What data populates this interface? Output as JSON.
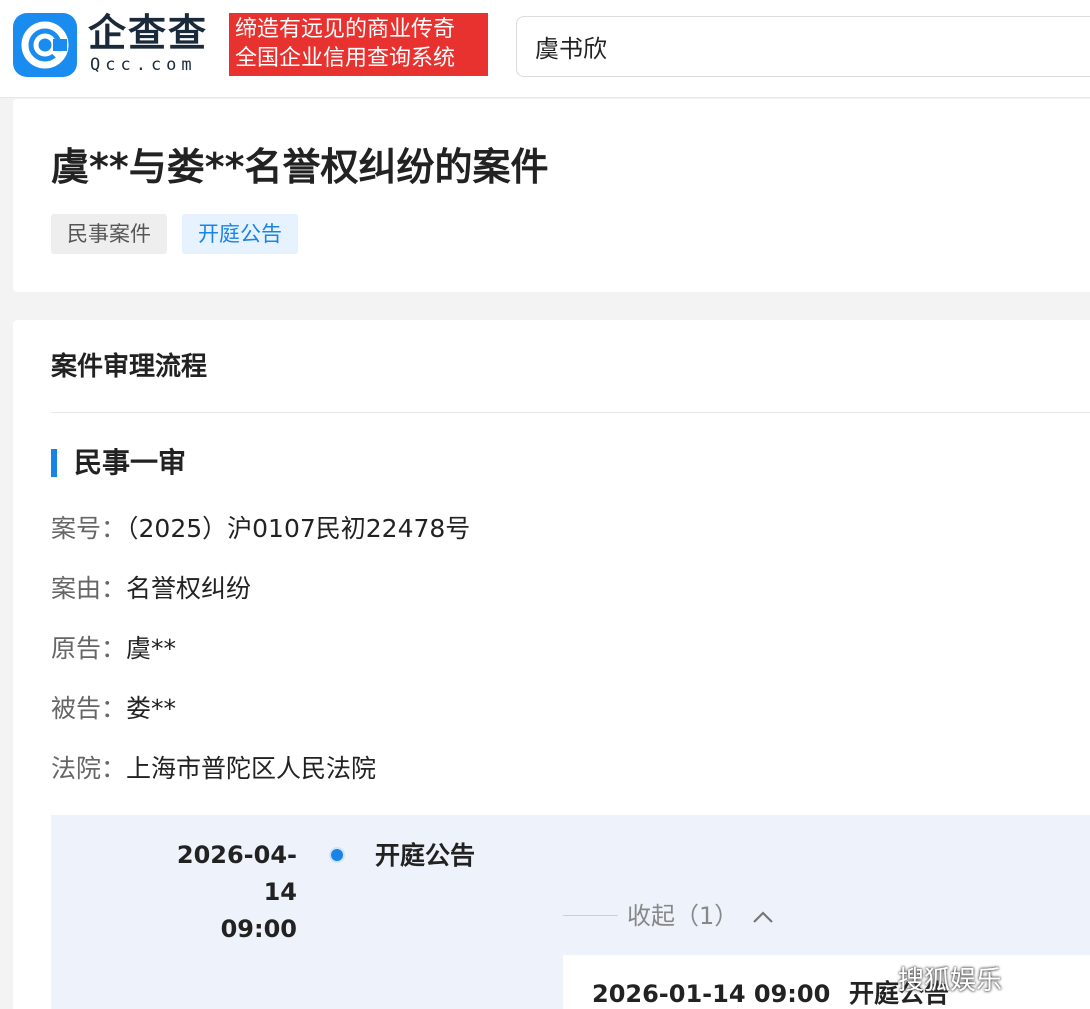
{
  "header": {
    "logo_text": "企查查",
    "logo_domain": "Qcc.com",
    "slogan_line1": "缔造有远见的商业传奇",
    "slogan_line2": "全国企业信用查询系统",
    "search_value": "虞书欣"
  },
  "case": {
    "title": "虞**与娄**名誉权纠纷的案件",
    "tags": [
      "民事案件",
      "开庭公告"
    ]
  },
  "process": {
    "section_title": "案件审理流程",
    "stage_title": "民事一审",
    "fields": [
      {
        "label": "案号：",
        "value": "（2025）沪0107民初22478号"
      },
      {
        "label": "案由：",
        "value": "名誉权纠纷"
      },
      {
        "label": "原告：",
        "value": "虞**"
      },
      {
        "label": "被告：",
        "value": "娄**"
      },
      {
        "label": "法院：",
        "value": "上海市普陀区人民法院"
      }
    ],
    "timeline": {
      "date_line1": "2026-04-14",
      "date_line2": "09:00",
      "event": "开庭公告",
      "collapse_label": "收起（1）",
      "collapse_icon": "chevron-up-icon",
      "sub_date": "2026-01-14 09:00",
      "sub_event": "开庭公告"
    }
  },
  "watermark": "搜狐娱乐",
  "colors": {
    "brand_blue": "#1a8cf0",
    "slogan_red": "#e8322f",
    "accent_blue": "#1a84e6"
  }
}
